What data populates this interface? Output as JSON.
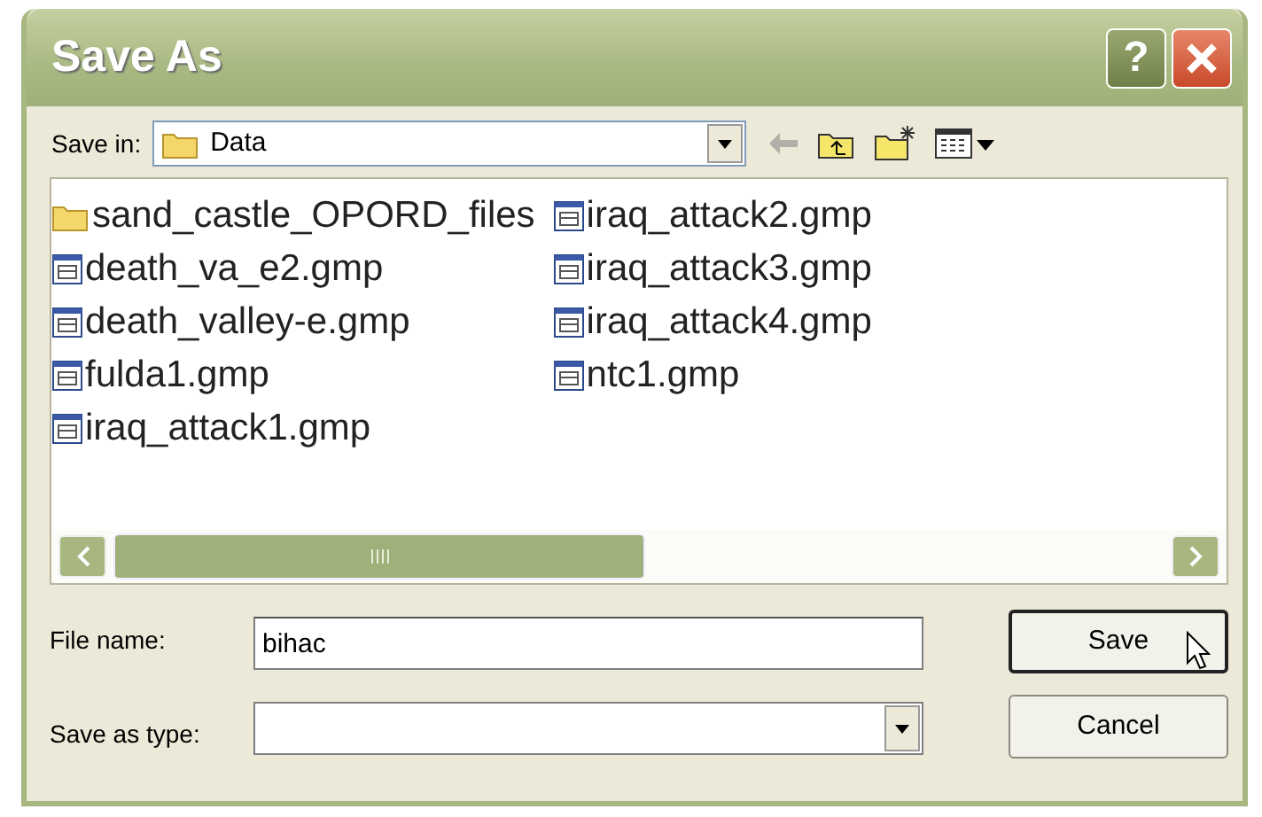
{
  "window": {
    "title": "Save As",
    "help_button": "?"
  },
  "save_in": {
    "label": "Save in:",
    "value": "Data"
  },
  "files": [
    {
      "name": "sand_castle_OPORD_files",
      "kind": "folder"
    },
    {
      "name": "death_va_e2.gmp",
      "kind": "file"
    },
    {
      "name": "death_valley-e.gmp",
      "kind": "file"
    },
    {
      "name": "fulda1.gmp",
      "kind": "file"
    },
    {
      "name": "iraq_attack1.gmp",
      "kind": "file"
    },
    {
      "name": "iraq_attack2.gmp",
      "kind": "file"
    },
    {
      "name": "iraq_attack3.gmp",
      "kind": "file"
    },
    {
      "name": "iraq_attack4.gmp",
      "kind": "file"
    },
    {
      "name": "ntc1.gmp",
      "kind": "file"
    }
  ],
  "file_name": {
    "label": "File name:",
    "value": "bihac"
  },
  "save_as_type": {
    "label": "Save as type:"
  },
  "buttons": [
    {
      "label": "Save",
      "default": true
    },
    {
      "label": "Cancel",
      "default": false
    }
  ]
}
